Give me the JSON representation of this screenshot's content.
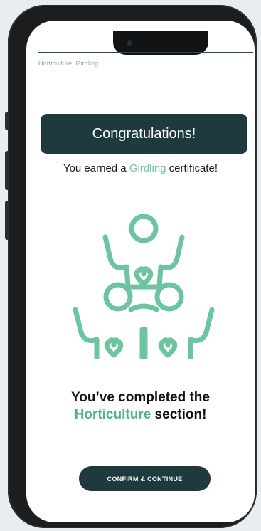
{
  "breadcrumb": "Horticulture: Girdling",
  "banner": {
    "title": "Congratulations!"
  },
  "certificate": {
    "prefix": "You earned a ",
    "name": "Girdling",
    "suffix": " certificate!"
  },
  "completion": {
    "line1": "You’ve completed the",
    "section": "Horticulture",
    "suffix": " section!"
  },
  "actions": {
    "confirm_label": "CONFIRM & CONTINUE"
  },
  "colors": {
    "accent": "#6dc59f",
    "dark": "#1f3a3f"
  },
  "icons": {
    "illustration": "celebrating-people-hearts-icon"
  }
}
